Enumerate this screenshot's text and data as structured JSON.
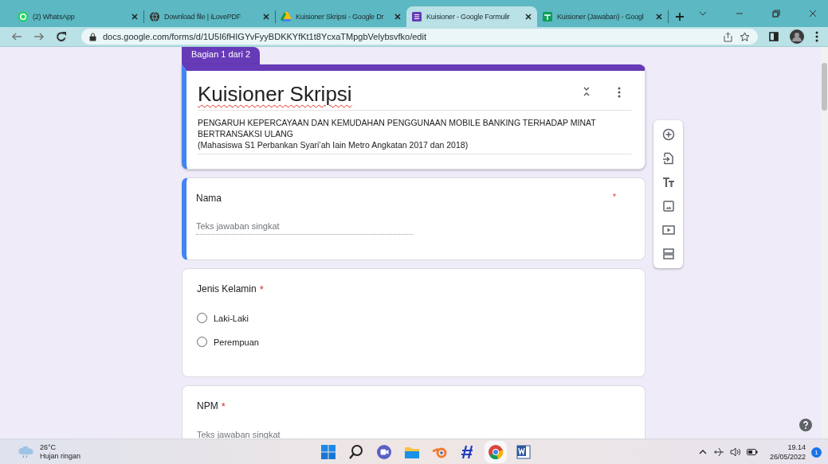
{
  "browser": {
    "tabs": [
      {
        "title": "(2) WhatsApp",
        "selected": false
      },
      {
        "title": "Download file | iLovePDF",
        "selected": false
      },
      {
        "title": "Kuisioner Skripsi - Google Dr",
        "selected": false
      },
      {
        "title": "Kuisioner - Google Formulir",
        "selected": true
      },
      {
        "title": "Kuisioner (Jawaban) - Googl",
        "selected": false
      }
    ],
    "url": "docs.google.com/forms/d/1U5I6fHIGYvFyyBDKKYfKt1t8YcxaTMpgbVelybsvfko/edit"
  },
  "form": {
    "section_tab": "Bagian 1 dari 2",
    "title": "Kuisioner Skripsi",
    "description": [
      "PENGARUH KEPERCAYAAN DAN KEMUDAHAN PENGGUNAAN MOBILE BANKING TERHADAP MINAT BERTRANSAKSI ULANG",
      "(Mahasiswa S1 Perbankan Syari’ah Iain Metro Angkatan 2017 dan 2018)"
    ],
    "questions": [
      {
        "kind": "short",
        "title": "Nama",
        "required": true,
        "required_mark": "*",
        "selected": true,
        "placeholder": "Teks jawaban singkat"
      },
      {
        "kind": "radio",
        "title": "Jenis Kelamin",
        "required": true,
        "required_mark": "*",
        "selected": false,
        "options": [
          {
            "label": "Laki-Laki",
            "selected": false
          },
          {
            "label": "Perempuan",
            "selected": false
          }
        ]
      },
      {
        "kind": "short",
        "title": "NPM",
        "required": true,
        "required_mark": "*",
        "selected": false,
        "placeholder": "Teks jawaban singkat"
      }
    ]
  },
  "taskbar": {
    "temperature": "26°C",
    "weather": "Hujan ringan",
    "time": "19.14",
    "date": "26/05/2022",
    "notifications": "1"
  }
}
